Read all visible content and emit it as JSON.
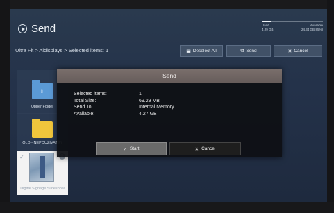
{
  "header": {
    "title": "Send",
    "storage": {
      "used_label": "Used",
      "used_value": "4.29 GB",
      "available_label": "Available",
      "available_value": "24.34 GB(85%)",
      "used_fraction": 0.15
    }
  },
  "toolbar": {
    "breadcrumb": "Ultra Fit > Aldisplays > Selected items: 1",
    "deselect_label": "Deselect All",
    "send_label": "Send",
    "cancel_label": "Cancel"
  },
  "tiles": {
    "upper_folder": "Upper Folder",
    "old_folder": "OLD - NEPOUZIVAT P(",
    "signage": "Digital Signage Slideshow"
  },
  "dialog": {
    "title": "Send",
    "rows": [
      {
        "key": "Selected items:",
        "value": "1"
      },
      {
        "key": "Total Size:",
        "value": "69.29 MB"
      },
      {
        "key": "Send To:",
        "value": "Internal Memory"
      },
      {
        "key": "Available:",
        "value": "4.27 GB"
      }
    ],
    "start_label": "Start",
    "cancel_label": "Cancel"
  },
  "icons": {
    "send_header": "play-circle-icon",
    "deselect": "deselect-icon",
    "send": "send-icon",
    "cancel": "x-icon",
    "check": "check-icon",
    "gear": "gear-icon"
  }
}
